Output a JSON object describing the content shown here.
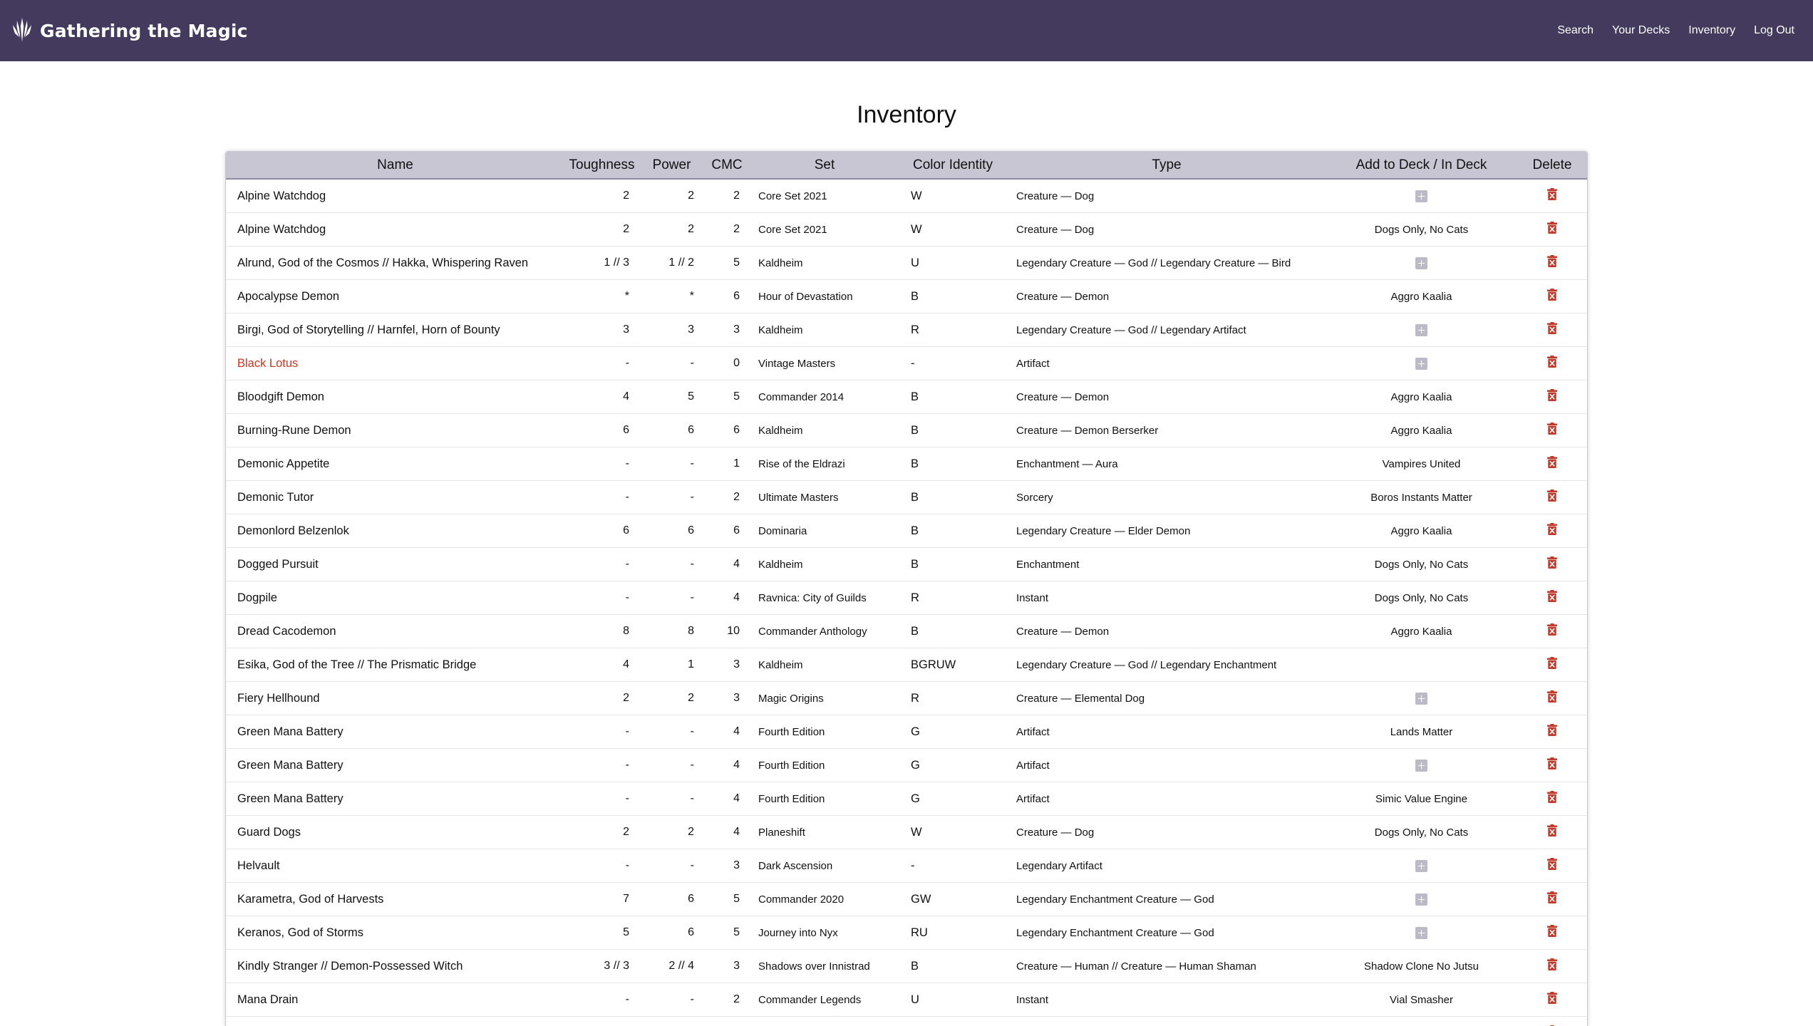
{
  "app": {
    "title": "Gathering the Magic",
    "nav": [
      "Search",
      "Your Decks",
      "Inventory",
      "Log Out"
    ]
  },
  "page": {
    "title": "Inventory"
  },
  "table": {
    "columns": [
      "Name",
      "Toughness",
      "Power",
      "CMC",
      "Set",
      "Color Identity",
      "Type",
      "Add to Deck / In Deck",
      "Delete"
    ],
    "rows": [
      {
        "name": "Alpine Watchdog",
        "toughness": "2",
        "power": "2",
        "cmc": "2",
        "set": "Core Set 2021",
        "color_identity": "W",
        "type": "Creature — Dog",
        "deck": ""
      },
      {
        "name": "Alpine Watchdog",
        "toughness": "2",
        "power": "2",
        "cmc": "2",
        "set": "Core Set 2021",
        "color_identity": "W",
        "type": "Creature — Dog",
        "deck": "Dogs Only, No Cats"
      },
      {
        "name": "Alrund, God of the Cosmos // Hakka, Whispering Raven",
        "toughness": "1 // 3",
        "power": "1 // 2",
        "cmc": "5",
        "set": "Kaldheim",
        "color_identity": "U",
        "type": "Legendary Creature — God // Legendary Creature — Bird",
        "deck": ""
      },
      {
        "name": "Apocalypse Demon",
        "toughness": "*",
        "power": "*",
        "cmc": "6",
        "set": "Hour of Devastation",
        "color_identity": "B",
        "type": "Creature — Demon",
        "deck": "Aggro Kaalia"
      },
      {
        "name": "Birgi, God of Storytelling // Harnfel, Horn of Bounty",
        "toughness": "3",
        "power": "3",
        "cmc": "3",
        "set": "Kaldheim",
        "color_identity": "R",
        "type": "Legendary Creature — God // Legendary Artifact",
        "deck": ""
      },
      {
        "name": "Black Lotus",
        "toughness": "-",
        "power": "-",
        "cmc": "0",
        "set": "Vintage Masters",
        "color_identity": "-",
        "type": "Artifact",
        "deck": "",
        "highlight": true
      },
      {
        "name": "Bloodgift Demon",
        "toughness": "4",
        "power": "5",
        "cmc": "5",
        "set": "Commander 2014",
        "color_identity": "B",
        "type": "Creature — Demon",
        "deck": "Aggro Kaalia"
      },
      {
        "name": "Burning-Rune Demon",
        "toughness": "6",
        "power": "6",
        "cmc": "6",
        "set": "Kaldheim",
        "color_identity": "B",
        "type": "Creature — Demon Berserker",
        "deck": "Aggro Kaalia"
      },
      {
        "name": "Demonic Appetite",
        "toughness": "-",
        "power": "-",
        "cmc": "1",
        "set": "Rise of the Eldrazi",
        "color_identity": "B",
        "type": "Enchantment — Aura",
        "deck": "Vampires United"
      },
      {
        "name": "Demonic Tutor",
        "toughness": "-",
        "power": "-",
        "cmc": "2",
        "set": "Ultimate Masters",
        "color_identity": "B",
        "type": "Sorcery",
        "deck": "Boros Instants Matter"
      },
      {
        "name": "Demonlord Belzenlok",
        "toughness": "6",
        "power": "6",
        "cmc": "6",
        "set": "Dominaria",
        "color_identity": "B",
        "type": "Legendary Creature — Elder Demon",
        "deck": "Aggro Kaalia"
      },
      {
        "name": "Dogged Pursuit",
        "toughness": "-",
        "power": "-",
        "cmc": "4",
        "set": "Kaldheim",
        "color_identity": "B",
        "type": "Enchantment",
        "deck": "Dogs Only, No Cats"
      },
      {
        "name": "Dogpile",
        "toughness": "-",
        "power": "-",
        "cmc": "4",
        "set": "Ravnica: City of Guilds",
        "color_identity": "R",
        "type": "Instant",
        "deck": "Dogs Only, No Cats"
      },
      {
        "name": "Dread Cacodemon",
        "toughness": "8",
        "power": "8",
        "cmc": "10",
        "set": "Commander Anthology",
        "color_identity": "B",
        "type": "Creature — Demon",
        "deck": "Aggro Kaalia"
      },
      {
        "name": "Esika, God of the Tree // The Prismatic Bridge",
        "toughness": "4",
        "power": "1",
        "cmc": "3",
        "set": "Kaldheim",
        "color_identity": "BGRUW",
        "type": "Legendary Creature — God // Legendary Enchantment",
        "deck": "",
        "no_add": true
      },
      {
        "name": "Fiery Hellhound",
        "toughness": "2",
        "power": "2",
        "cmc": "3",
        "set": "Magic Origins",
        "color_identity": "R",
        "type": "Creature — Elemental Dog",
        "deck": ""
      },
      {
        "name": "Green Mana Battery",
        "toughness": "-",
        "power": "-",
        "cmc": "4",
        "set": "Fourth Edition",
        "color_identity": "G",
        "type": "Artifact",
        "deck": "Lands Matter"
      },
      {
        "name": "Green Mana Battery",
        "toughness": "-",
        "power": "-",
        "cmc": "4",
        "set": "Fourth Edition",
        "color_identity": "G",
        "type": "Artifact",
        "deck": ""
      },
      {
        "name": "Green Mana Battery",
        "toughness": "-",
        "power": "-",
        "cmc": "4",
        "set": "Fourth Edition",
        "color_identity": "G",
        "type": "Artifact",
        "deck": "Simic Value Engine"
      },
      {
        "name": "Guard Dogs",
        "toughness": "2",
        "power": "2",
        "cmc": "4",
        "set": "Planeshift",
        "color_identity": "W",
        "type": "Creature — Dog",
        "deck": "Dogs Only, No Cats"
      },
      {
        "name": "Helvault",
        "toughness": "-",
        "power": "-",
        "cmc": "3",
        "set": "Dark Ascension",
        "color_identity": "-",
        "type": "Legendary Artifact",
        "deck": ""
      },
      {
        "name": "Karametra, God of Harvests",
        "toughness": "7",
        "power": "6",
        "cmc": "5",
        "set": "Commander 2020",
        "color_identity": "GW",
        "type": "Legendary Enchantment Creature — God",
        "deck": ""
      },
      {
        "name": "Keranos, God of Storms",
        "toughness": "5",
        "power": "6",
        "cmc": "5",
        "set": "Journey into Nyx",
        "color_identity": "RU",
        "type": "Legendary Enchantment Creature — God",
        "deck": ""
      },
      {
        "name": "Kindly Stranger // Demon-Possessed Witch",
        "toughness": "3 // 3",
        "power": "2 // 4",
        "cmc": "3",
        "set": "Shadows over Innistrad",
        "color_identity": "B",
        "type": "Creature — Human // Creature — Human Shaman",
        "deck": "Shadow Clone No Jutsu"
      },
      {
        "name": "Mana Drain",
        "toughness": "-",
        "power": "-",
        "cmc": "2",
        "set": "Commander Legends",
        "color_identity": "U",
        "type": "Instant",
        "deck": "Vial Smasher"
      },
      {
        "name": "",
        "toughness": "-",
        "power": "-",
        "cmc": "",
        "set": "",
        "color_identity": "",
        "type": "",
        "deck": "",
        "no_add": true
      }
    ]
  },
  "colors": {
    "header_bg": "#433a5e",
    "table_header_bg": "#c9c6d4",
    "add_icon": "#bdbac7",
    "delete_icon": "#c0392b",
    "highlight_text": "#d1331f"
  },
  "icons": {
    "brand": "planeswalker-icon",
    "add": "plus-square-icon",
    "delete": "trash-icon"
  }
}
